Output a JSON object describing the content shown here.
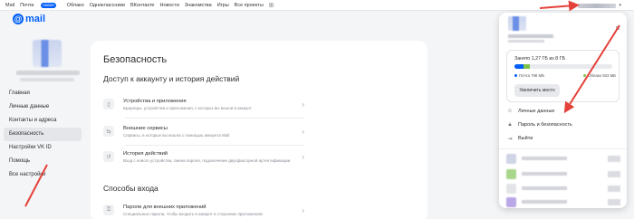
{
  "topbar": {
    "nav": [
      "Mail",
      "Почта",
      "Облако",
      "Одноклассники",
      "ВКонтакте",
      "Новости",
      "Знакомства",
      "Игры",
      "Все проекты"
    ],
    "mail_badge": "новое"
  },
  "logo": {
    "symbol": "@",
    "text": "mail"
  },
  "sidebar": {
    "items": [
      {
        "label": "Главная",
        "active": false
      },
      {
        "label": "Личные данные",
        "active": false
      },
      {
        "label": "Контакты и адреса",
        "active": false
      },
      {
        "label": "Безопасность",
        "active": true
      },
      {
        "label": "Настройки VK ID",
        "active": false,
        "arrow": "›"
      },
      {
        "label": "Помощь",
        "active": false,
        "arrow": "›"
      },
      {
        "label": "Все настройки",
        "active": false,
        "arrow": "›"
      }
    ]
  },
  "main": {
    "title": "Безопасность",
    "section1": "Доступ к аккаунту и история действий",
    "rows1": [
      {
        "title": "Устройства и приложения",
        "subtitle": "Браузеры, устройства и приложения, с которых вы вошли в аккаунт",
        "icon": "phone-icon"
      },
      {
        "title": "Внешние сервисы",
        "subtitle": "Сервисы, в которые вы вошли с помощью аккаунта Mail",
        "icon": "external-services-icon"
      },
      {
        "title": "История действий",
        "subtitle": "Вход с нового устройства, смена пароля, подключение двухфакторной аутентификации",
        "icon": "history-icon"
      }
    ],
    "section2": "Способы входа",
    "rows2": [
      {
        "title": "Пароли для внешних приложений",
        "subtitle": "Специальные пароли, чтобы входить в аккаунт в сторонних приложениях",
        "icon": "key-icon"
      }
    ]
  },
  "panel": {
    "storage_text": "Занято 1,27 ГБ из 8 ГБ",
    "mail_label": "Почта 798 МБ",
    "cloud_label": "Облако 503 МБ",
    "mail_fraction": 0.097,
    "cloud_fraction": 0.061,
    "more_space": "Увеличить место",
    "menu": [
      {
        "label": "Личные данные",
        "icon": "person-icon"
      },
      {
        "label": "Пароль и безопасность",
        "icon": "lock-icon"
      },
      {
        "label": "Выйти",
        "icon": "logout-icon"
      }
    ]
  },
  "colors": {
    "accent": "#005ff9",
    "cloud": "#7ec24a",
    "annotation": "#e4413a"
  }
}
